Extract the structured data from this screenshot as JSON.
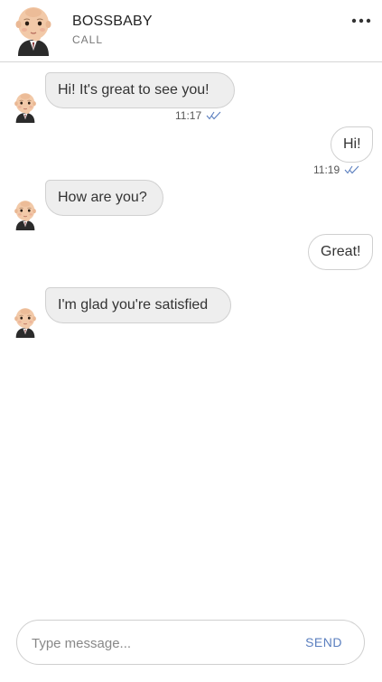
{
  "header": {
    "name": "BOSSBABY",
    "subtitle": "CALL",
    "more_icon": "more-horizontal-icon"
  },
  "messages": [
    {
      "direction": "incoming",
      "text": "Hi! It's great to see you!",
      "time": "11:17",
      "read": true
    },
    {
      "direction": "outgoing",
      "text": "Hi!",
      "time": "11:19",
      "read": true
    },
    {
      "direction": "incoming",
      "text": "How are you?"
    },
    {
      "direction": "outgoing",
      "text": "Great!"
    },
    {
      "direction": "incoming",
      "text": "I'm glad you're satisfied"
    }
  ],
  "composer": {
    "placeholder": "Type message...",
    "value": "",
    "send_label": "SEND"
  },
  "colors": {
    "accent": "#5b7fbf",
    "incoming_bubble": "#eeeeee",
    "outgoing_bubble": "#ffffff",
    "divider": "#d6d6d6"
  }
}
